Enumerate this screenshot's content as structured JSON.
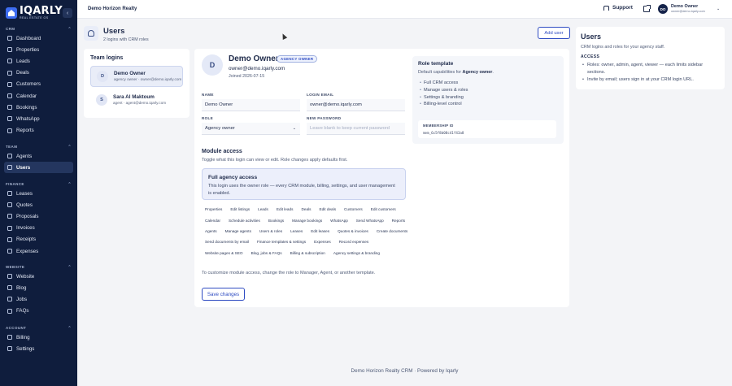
{
  "brand": {
    "name": "IQARLY",
    "tagline": "REAL ESTATE OS"
  },
  "sidebar": {
    "sections": [
      {
        "heading": "CRM",
        "items": [
          {
            "label": "Dashboard",
            "icon": "dashboard-icon"
          },
          {
            "label": "Properties",
            "icon": "building-icon"
          },
          {
            "label": "Leads",
            "icon": "funnel-icon"
          },
          {
            "label": "Deals",
            "icon": "handshake-icon"
          },
          {
            "label": "Customers",
            "icon": "people-icon"
          },
          {
            "label": "Calendar",
            "icon": "calendar-icon"
          },
          {
            "label": "Bookings",
            "icon": "booking-icon"
          },
          {
            "label": "WhatsApp",
            "icon": "whatsapp-icon"
          },
          {
            "label": "Reports",
            "icon": "chart-icon"
          }
        ]
      },
      {
        "heading": "TEAM",
        "items": [
          {
            "label": "Agents",
            "icon": "agent-icon"
          },
          {
            "label": "Users",
            "icon": "users-icon",
            "active": true
          }
        ]
      },
      {
        "heading": "FINANCE",
        "items": [
          {
            "label": "Leases",
            "icon": "lease-icon"
          },
          {
            "label": "Quotes",
            "icon": "quote-icon"
          },
          {
            "label": "Proposals",
            "icon": "proposal-icon"
          },
          {
            "label": "Invoices",
            "icon": "invoice-icon"
          },
          {
            "label": "Receipts",
            "icon": "receipt-icon"
          },
          {
            "label": "Expenses",
            "icon": "wallet-icon"
          }
        ]
      },
      {
        "heading": "WEBSITE",
        "items": [
          {
            "label": "Website",
            "icon": "globe-icon"
          },
          {
            "label": "Blog",
            "icon": "blog-icon"
          },
          {
            "label": "Jobs",
            "icon": "briefcase-icon"
          },
          {
            "label": "FAQs",
            "icon": "help-icon"
          }
        ]
      },
      {
        "heading": "ACCOUNT",
        "items": [
          {
            "label": "Billing",
            "icon": "card-icon"
          },
          {
            "label": "Settings",
            "icon": "gear-icon"
          }
        ]
      }
    ]
  },
  "topbar": {
    "org_name": "Demo Horizon Realty",
    "support_label": "Support",
    "user_initials": "DO",
    "user_name": "Demo Owner",
    "user_email": "owner@demo.iqarly.com"
  },
  "page": {
    "title": "Users",
    "subtitle": "2 logins with CRM roles",
    "add_user_label": "Add user"
  },
  "team": {
    "title": "Team logins",
    "logins": [
      {
        "initial": "D",
        "name": "Demo Owner",
        "meta": "agency owner · owner@demo.iqarly.com",
        "selected": true
      },
      {
        "initial": "S",
        "name": "Sara Al Maktoum",
        "meta": "agent · agent@demo.iqarly.com",
        "selected": false
      }
    ]
  },
  "editor": {
    "initial": "D",
    "name": "Demo Owner",
    "badge": "AGENCY OWNER",
    "email": "owner@demo.iqarly.com",
    "joined": "Joined 2026-07-15",
    "fields": {
      "name_label": "NAME",
      "name_value": "Demo Owner",
      "email_label": "LOGIN EMAIL",
      "email_value": "owner@demo.iqarly.com",
      "role_label": "ROLE",
      "role_value": "Agency owner",
      "password_label": "NEW PASSWORD",
      "password_placeholder": "Leave blank to keep current password"
    },
    "role_template": {
      "title": "Role template",
      "sub_prefix": "Default capabilities for",
      "sub_role": "Agency owner",
      "bullets": [
        "Full CRM access",
        "Manage users & roles",
        "Settings & branding",
        "Billing-level control"
      ],
      "membership_label": "MEMBERSHIP ID",
      "membership_value": "mem_6c5f8b08c41f43a8"
    },
    "module_access": {
      "title": "Module access",
      "subtitle": "Toggle what this login can view or edit. Role changes apply defaults first.",
      "full_title": "Full agency access",
      "full_desc": "This login uses the owner role — every CRM module, billing, settings, and user management is enabled.",
      "chips": [
        "Properties",
        "Edit listings",
        "Leads",
        "Edit leads",
        "Deals",
        "Edit deals",
        "Customers",
        "Edit customers",
        "Calendar",
        "Schedule activities",
        "Bookings",
        "Manage bookings",
        "WhatsApp",
        "Send WhatsApp",
        "Reports",
        "Agents",
        "Manage agents",
        "Users & roles",
        "Leases",
        "Edit leases",
        "Quotes & invoices",
        "Create documents",
        "Send documents by email",
        "Finance templates & settings",
        "Expenses",
        "Record expenses",
        "Website pages & SEO",
        "Blog, jobs & FAQs",
        "Billing & subscription",
        "Agency settings & branding"
      ],
      "customize_note": "To customize module access, change the role to Manager, Agent, or another template.",
      "save_label": "Save changes"
    }
  },
  "help": {
    "title": "Users",
    "subtitle": "CRM logins and roles for your agency staff.",
    "access_label": "ACCESS",
    "bullets": [
      "Roles: owner, admin, agent, viewer — each limits sidebar sections.",
      "Invite by email; users sign in at your CRM login URL."
    ]
  },
  "footer": "Demo Horizon Realty CRM · Powered by Iqarly",
  "colors": {
    "sidebar_bg": "#0f1d3d",
    "accent": "#2f4cc2",
    "page_bg": "#f3f4f7"
  }
}
